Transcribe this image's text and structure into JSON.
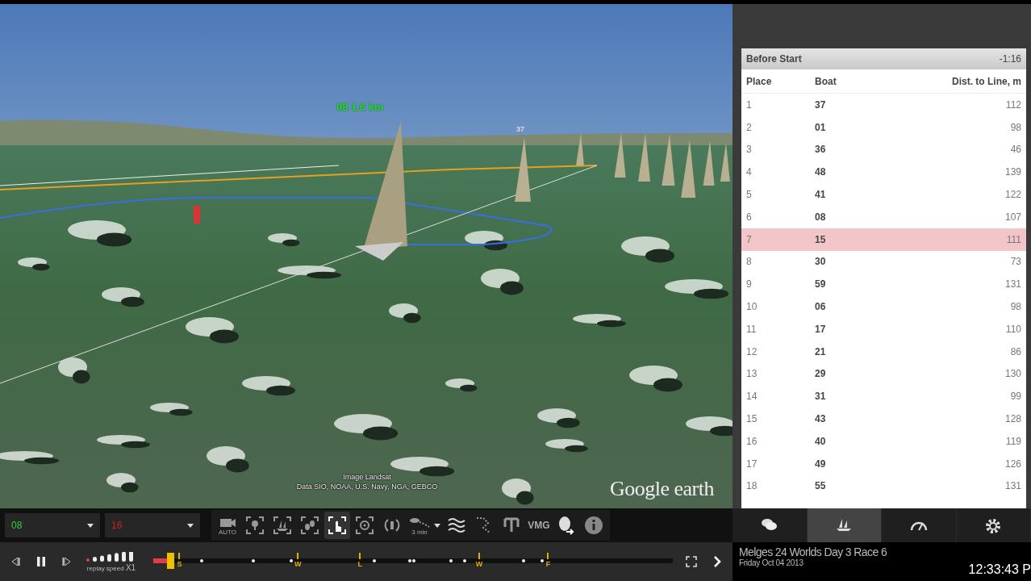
{
  "map": {
    "boat_label": "08 1.6 km",
    "mark_label": "37",
    "attribution": [
      "Image Landsat",
      "Data SIO, NOAA, U.S. Navy, NGA, GEBCO"
    ],
    "logo": "Google earth"
  },
  "leaderboard": {
    "title": "Before Start",
    "countdown": "-1:16",
    "columns": [
      "Place",
      "Boat",
      "Dist. to Line, m"
    ],
    "rows": [
      {
        "place": "1",
        "boat": "37",
        "dist": "112",
        "selected": false
      },
      {
        "place": "2",
        "boat": "01",
        "dist": "98",
        "selected": false
      },
      {
        "place": "3",
        "boat": "36",
        "dist": "46",
        "selected": false
      },
      {
        "place": "4",
        "boat": "48",
        "dist": "139",
        "selected": false
      },
      {
        "place": "5",
        "boat": "41",
        "dist": "122",
        "selected": false
      },
      {
        "place": "6",
        "boat": "08",
        "dist": "107",
        "selected": false
      },
      {
        "place": "7",
        "boat": "15",
        "dist": "111",
        "selected": true
      },
      {
        "place": "8",
        "boat": "30",
        "dist": "73",
        "selected": false
      },
      {
        "place": "9",
        "boat": "59",
        "dist": "131",
        "selected": false
      },
      {
        "place": "10",
        "boat": "06",
        "dist": "98",
        "selected": false
      },
      {
        "place": "11",
        "boat": "17",
        "dist": "110",
        "selected": false
      },
      {
        "place": "12",
        "boat": "21",
        "dist": "86",
        "selected": false
      },
      {
        "place": "13",
        "boat": "29",
        "dist": "130",
        "selected": false
      },
      {
        "place": "14",
        "boat": "31",
        "dist": "99",
        "selected": false
      },
      {
        "place": "15",
        "boat": "43",
        "dist": "128",
        "selected": false
      },
      {
        "place": "16",
        "boat": "40",
        "dist": "119",
        "selected": false
      },
      {
        "place": "17",
        "boat": "49",
        "dist": "126",
        "selected": false
      },
      {
        "place": "18",
        "boat": "55",
        "dist": "131",
        "selected": false
      }
    ]
  },
  "boat_selectors": [
    {
      "value": "08",
      "color": "#33cc33"
    },
    {
      "value": "16",
      "color": "#cc2222"
    }
  ],
  "toolbar": [
    {
      "kind": "camera",
      "text": "AUTO",
      "selected": false
    },
    {
      "kind": "frame",
      "selected": false
    },
    {
      "kind": "fleet",
      "selected": false
    },
    {
      "kind": "marks",
      "selected": false
    },
    {
      "kind": "pointer",
      "selected": true
    },
    {
      "kind": "wheel",
      "selected": false
    },
    {
      "kind": "rotate",
      "selected": false
    },
    {
      "kind": "trail",
      "text": "3 min",
      "selected": false
    },
    {
      "kind": "wind",
      "selected": false
    },
    {
      "kind": "path",
      "selected": false
    },
    {
      "kind": "gauge",
      "selected": false
    },
    {
      "kind": "vmg",
      "text": "VMG",
      "selected": false
    },
    {
      "kind": "export",
      "selected": false
    },
    {
      "kind": "info",
      "selected": false
    }
  ],
  "playback": {
    "speed_label": "replay speed",
    "speed_value": "X1",
    "level": 0.03,
    "marks": [
      "S",
      "W",
      "L",
      "W",
      "F"
    ]
  },
  "panel_tabs": [
    {
      "kind": "chat",
      "selected": false
    },
    {
      "kind": "boats",
      "selected": true
    },
    {
      "kind": "speed",
      "selected": false
    },
    {
      "kind": "settings",
      "selected": false
    }
  ],
  "event": {
    "title": "Melges 24 Worlds Day 3 Race 6",
    "date": "Friday Oct 04 2013",
    "clock": "12:33:43 P"
  }
}
